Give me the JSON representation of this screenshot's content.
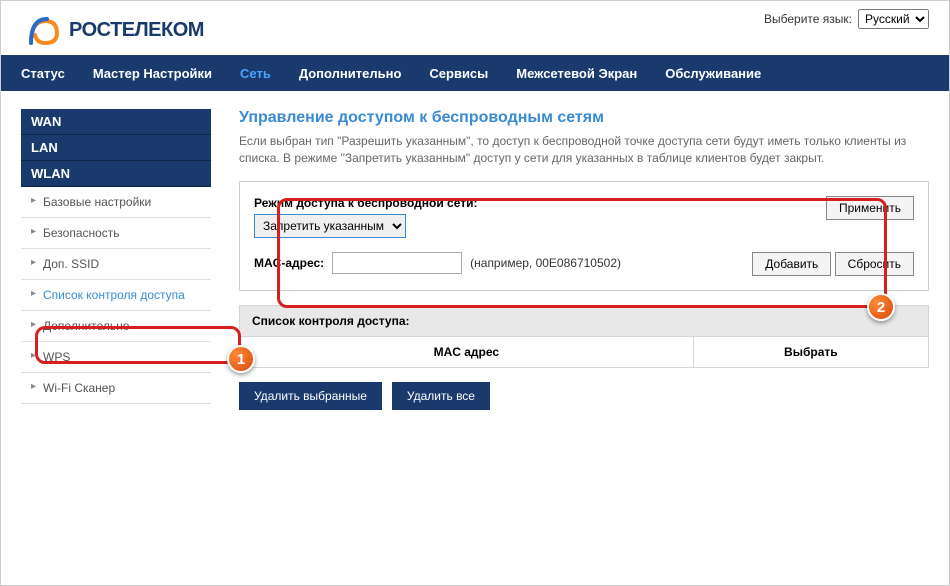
{
  "lang": {
    "label": "Выберите язык:",
    "value": "Русский"
  },
  "logo": {
    "text": "РОСТЕЛЕКОМ"
  },
  "topnav": {
    "items": [
      {
        "label": "Статус",
        "active": false
      },
      {
        "label": "Мастер Настройки",
        "active": false
      },
      {
        "label": "Сеть",
        "active": true
      },
      {
        "label": "Дополнительно",
        "active": false
      },
      {
        "label": "Сервисы",
        "active": false
      },
      {
        "label": "Межсетевой Экран",
        "active": false
      },
      {
        "label": "Обслуживание",
        "active": false
      }
    ]
  },
  "sidebar": {
    "headers": [
      "WAN",
      "LAN",
      "WLAN"
    ],
    "wlan_items": [
      {
        "label": "Базовые настройки",
        "active": false
      },
      {
        "label": "Безопасность",
        "active": false
      },
      {
        "label": "Доп. SSID",
        "active": false
      },
      {
        "label": "Список контроля доступа",
        "active": true
      },
      {
        "label": "Дополнительно",
        "active": false
      },
      {
        "label": "WPS",
        "active": false
      },
      {
        "label": "Wi-Fi Сканер",
        "active": false
      }
    ]
  },
  "content": {
    "title": "Управление доступом к беспроводным сетям",
    "description": "Если выбран тип \"Разрешить указанным\", то доступ к беспроводной точке доступа сети будут иметь только клиенты из списка. В режиме \"Запретить указанным\" доступ у сети для указанных в таблице клиентов будет закрыт.",
    "mode_label": "Режим доступа к беспроводной сети:",
    "mode_value": "Запретить указанным",
    "apply_label": "Применить",
    "mac_label": "MAC-адрес:",
    "mac_value": "",
    "mac_hint": "(например, 00E086710502)",
    "add_label": "Добавить",
    "reset_label": "Сбросить",
    "list_title": "Список контроля доступа:",
    "col_mac": "MAC адрес",
    "col_select": "Выбрать",
    "delete_selected": "Удалить выбранные",
    "delete_all": "Удалить все"
  },
  "annotations": {
    "badge1": "1",
    "badge2": "2"
  }
}
